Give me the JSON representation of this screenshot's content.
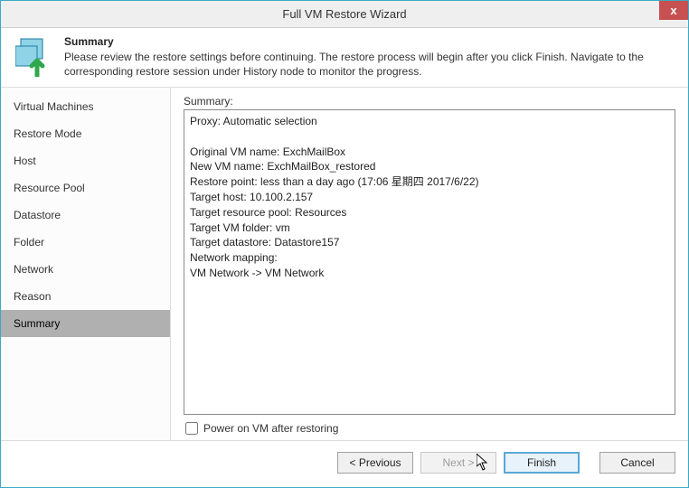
{
  "window": {
    "title": "Full VM Restore Wizard",
    "close_symbol": "x"
  },
  "header": {
    "title": "Summary",
    "subtitle": "Please review the restore settings before continuing. The restore process will begin after you click Finish. Navigate to the corresponding restore session under History node to monitor the progress."
  },
  "sidebar": {
    "items": [
      {
        "label": "Virtual Machines"
      },
      {
        "label": "Restore Mode"
      },
      {
        "label": "Host"
      },
      {
        "label": "Resource Pool"
      },
      {
        "label": "Datastore"
      },
      {
        "label": "Folder"
      },
      {
        "label": "Network"
      },
      {
        "label": "Reason"
      },
      {
        "label": "Summary",
        "selected": true
      }
    ]
  },
  "content": {
    "summary_label": "Summary:",
    "summary_text": "Proxy: Automatic selection\n\nOriginal VM name: ExchMailBox\nNew VM name: ExchMailBox_restored\nRestore point: less than a day ago (17:06 星期四 2017/6/22)\nTarget host: 10.100.2.157\nTarget resource pool: Resources\nTarget VM folder: vm\nTarget datastore: Datastore157\nNetwork mapping:\n        VM Network -> VM Network",
    "poweron_label": "Power on VM after restoring",
    "poweron_checked": false
  },
  "footer": {
    "previous": "< Previous",
    "next": "Next >",
    "finish": "Finish",
    "cancel": "Cancel"
  },
  "colors": {
    "accent_border": "#3aa9c4",
    "close_bg": "#c75050",
    "default_btn_border": "#5aa7d6"
  }
}
